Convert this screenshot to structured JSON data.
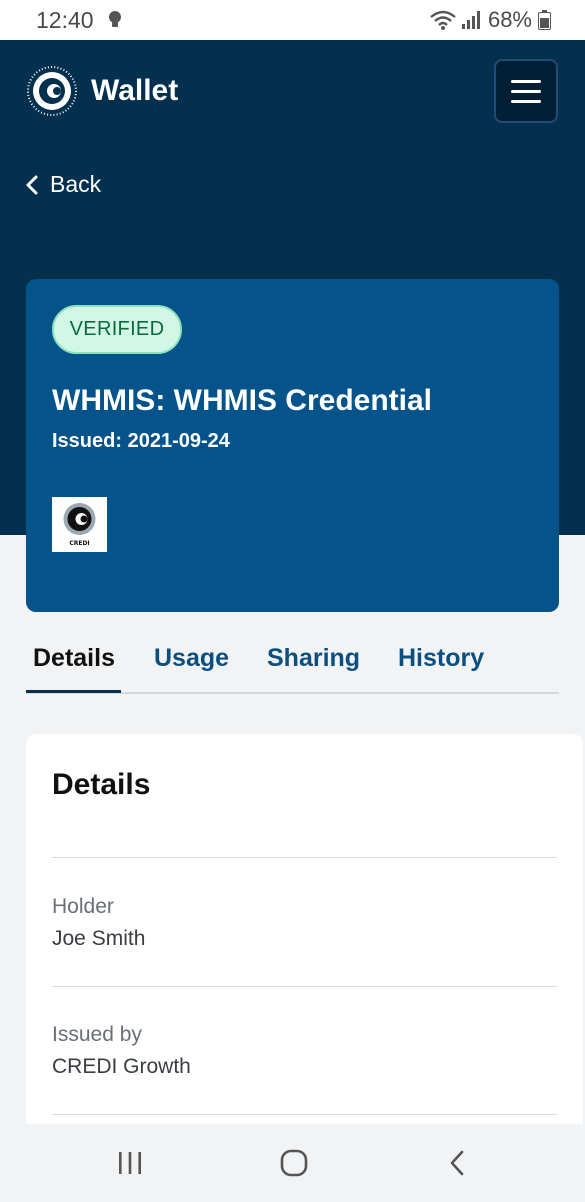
{
  "status_bar": {
    "time": "12:40",
    "battery": "68%",
    "icons": [
      "bulb-icon",
      "wifi-icon",
      "signal-icon",
      "battery-icon"
    ]
  },
  "header": {
    "app_title": "Wallet",
    "back_label": "Back",
    "colors": {
      "background": "#04304f",
      "menu_button": "#021f36"
    }
  },
  "credential": {
    "badge": "VERIFIED",
    "title": "WHMIS: WHMIS Credential",
    "issued": "Issued: 2021-09-24",
    "issuer_logo_text": "CREDI",
    "colors": {
      "card": "#04538a",
      "badge_bg": "#d2f7e6",
      "badge_text": "#0a6b3d"
    }
  },
  "tabs": [
    {
      "label": "Details",
      "active": true
    },
    {
      "label": "Usage",
      "active": false
    },
    {
      "label": "Sharing",
      "active": false
    },
    {
      "label": "History",
      "active": false
    }
  ],
  "details": {
    "heading": "Details",
    "fields": [
      {
        "label": "Holder",
        "value": "Joe Smith"
      },
      {
        "label": "Issued by",
        "value": "CREDI Growth"
      }
    ]
  },
  "nav_bar": {
    "icons": [
      "recent-apps-icon",
      "home-icon",
      "back-nav-icon"
    ]
  }
}
